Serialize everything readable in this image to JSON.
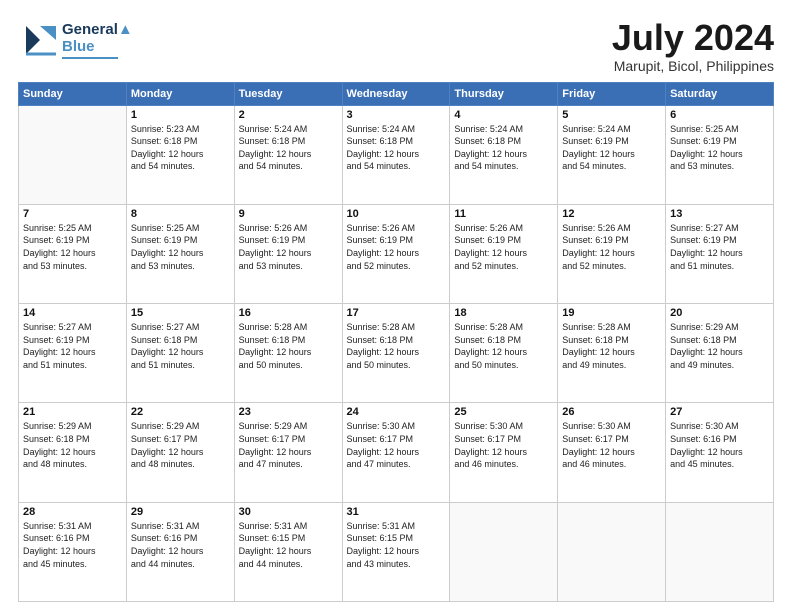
{
  "header": {
    "logo_line1": "General",
    "logo_line2": "Blue",
    "month": "July 2024",
    "location": "Marupit, Bicol, Philippines"
  },
  "weekdays": [
    "Sunday",
    "Monday",
    "Tuesday",
    "Wednesday",
    "Thursday",
    "Friday",
    "Saturday"
  ],
  "weeks": [
    [
      {
        "day": "",
        "info": ""
      },
      {
        "day": "1",
        "info": "Sunrise: 5:23 AM\nSunset: 6:18 PM\nDaylight: 12 hours\nand 54 minutes."
      },
      {
        "day": "2",
        "info": "Sunrise: 5:24 AM\nSunset: 6:18 PM\nDaylight: 12 hours\nand 54 minutes."
      },
      {
        "day": "3",
        "info": "Sunrise: 5:24 AM\nSunset: 6:18 PM\nDaylight: 12 hours\nand 54 minutes."
      },
      {
        "day": "4",
        "info": "Sunrise: 5:24 AM\nSunset: 6:18 PM\nDaylight: 12 hours\nand 54 minutes."
      },
      {
        "day": "5",
        "info": "Sunrise: 5:24 AM\nSunset: 6:19 PM\nDaylight: 12 hours\nand 54 minutes."
      },
      {
        "day": "6",
        "info": "Sunrise: 5:25 AM\nSunset: 6:19 PM\nDaylight: 12 hours\nand 53 minutes."
      }
    ],
    [
      {
        "day": "7",
        "info": "Sunrise: 5:25 AM\nSunset: 6:19 PM\nDaylight: 12 hours\nand 53 minutes."
      },
      {
        "day": "8",
        "info": "Sunrise: 5:25 AM\nSunset: 6:19 PM\nDaylight: 12 hours\nand 53 minutes."
      },
      {
        "day": "9",
        "info": "Sunrise: 5:26 AM\nSunset: 6:19 PM\nDaylight: 12 hours\nand 53 minutes."
      },
      {
        "day": "10",
        "info": "Sunrise: 5:26 AM\nSunset: 6:19 PM\nDaylight: 12 hours\nand 52 minutes."
      },
      {
        "day": "11",
        "info": "Sunrise: 5:26 AM\nSunset: 6:19 PM\nDaylight: 12 hours\nand 52 minutes."
      },
      {
        "day": "12",
        "info": "Sunrise: 5:26 AM\nSunset: 6:19 PM\nDaylight: 12 hours\nand 52 minutes."
      },
      {
        "day": "13",
        "info": "Sunrise: 5:27 AM\nSunset: 6:19 PM\nDaylight: 12 hours\nand 51 minutes."
      }
    ],
    [
      {
        "day": "14",
        "info": "Sunrise: 5:27 AM\nSunset: 6:19 PM\nDaylight: 12 hours\nand 51 minutes."
      },
      {
        "day": "15",
        "info": "Sunrise: 5:27 AM\nSunset: 6:18 PM\nDaylight: 12 hours\nand 51 minutes."
      },
      {
        "day": "16",
        "info": "Sunrise: 5:28 AM\nSunset: 6:18 PM\nDaylight: 12 hours\nand 50 minutes."
      },
      {
        "day": "17",
        "info": "Sunrise: 5:28 AM\nSunset: 6:18 PM\nDaylight: 12 hours\nand 50 minutes."
      },
      {
        "day": "18",
        "info": "Sunrise: 5:28 AM\nSunset: 6:18 PM\nDaylight: 12 hours\nand 50 minutes."
      },
      {
        "day": "19",
        "info": "Sunrise: 5:28 AM\nSunset: 6:18 PM\nDaylight: 12 hours\nand 49 minutes."
      },
      {
        "day": "20",
        "info": "Sunrise: 5:29 AM\nSunset: 6:18 PM\nDaylight: 12 hours\nand 49 minutes."
      }
    ],
    [
      {
        "day": "21",
        "info": "Sunrise: 5:29 AM\nSunset: 6:18 PM\nDaylight: 12 hours\nand 48 minutes."
      },
      {
        "day": "22",
        "info": "Sunrise: 5:29 AM\nSunset: 6:17 PM\nDaylight: 12 hours\nand 48 minutes."
      },
      {
        "day": "23",
        "info": "Sunrise: 5:29 AM\nSunset: 6:17 PM\nDaylight: 12 hours\nand 47 minutes."
      },
      {
        "day": "24",
        "info": "Sunrise: 5:30 AM\nSunset: 6:17 PM\nDaylight: 12 hours\nand 47 minutes."
      },
      {
        "day": "25",
        "info": "Sunrise: 5:30 AM\nSunset: 6:17 PM\nDaylight: 12 hours\nand 46 minutes."
      },
      {
        "day": "26",
        "info": "Sunrise: 5:30 AM\nSunset: 6:17 PM\nDaylight: 12 hours\nand 46 minutes."
      },
      {
        "day": "27",
        "info": "Sunrise: 5:30 AM\nSunset: 6:16 PM\nDaylight: 12 hours\nand 45 minutes."
      }
    ],
    [
      {
        "day": "28",
        "info": "Sunrise: 5:31 AM\nSunset: 6:16 PM\nDaylight: 12 hours\nand 45 minutes."
      },
      {
        "day": "29",
        "info": "Sunrise: 5:31 AM\nSunset: 6:16 PM\nDaylight: 12 hours\nand 44 minutes."
      },
      {
        "day": "30",
        "info": "Sunrise: 5:31 AM\nSunset: 6:15 PM\nDaylight: 12 hours\nand 44 minutes."
      },
      {
        "day": "31",
        "info": "Sunrise: 5:31 AM\nSunset: 6:15 PM\nDaylight: 12 hours\nand 43 minutes."
      },
      {
        "day": "",
        "info": ""
      },
      {
        "day": "",
        "info": ""
      },
      {
        "day": "",
        "info": ""
      }
    ]
  ]
}
